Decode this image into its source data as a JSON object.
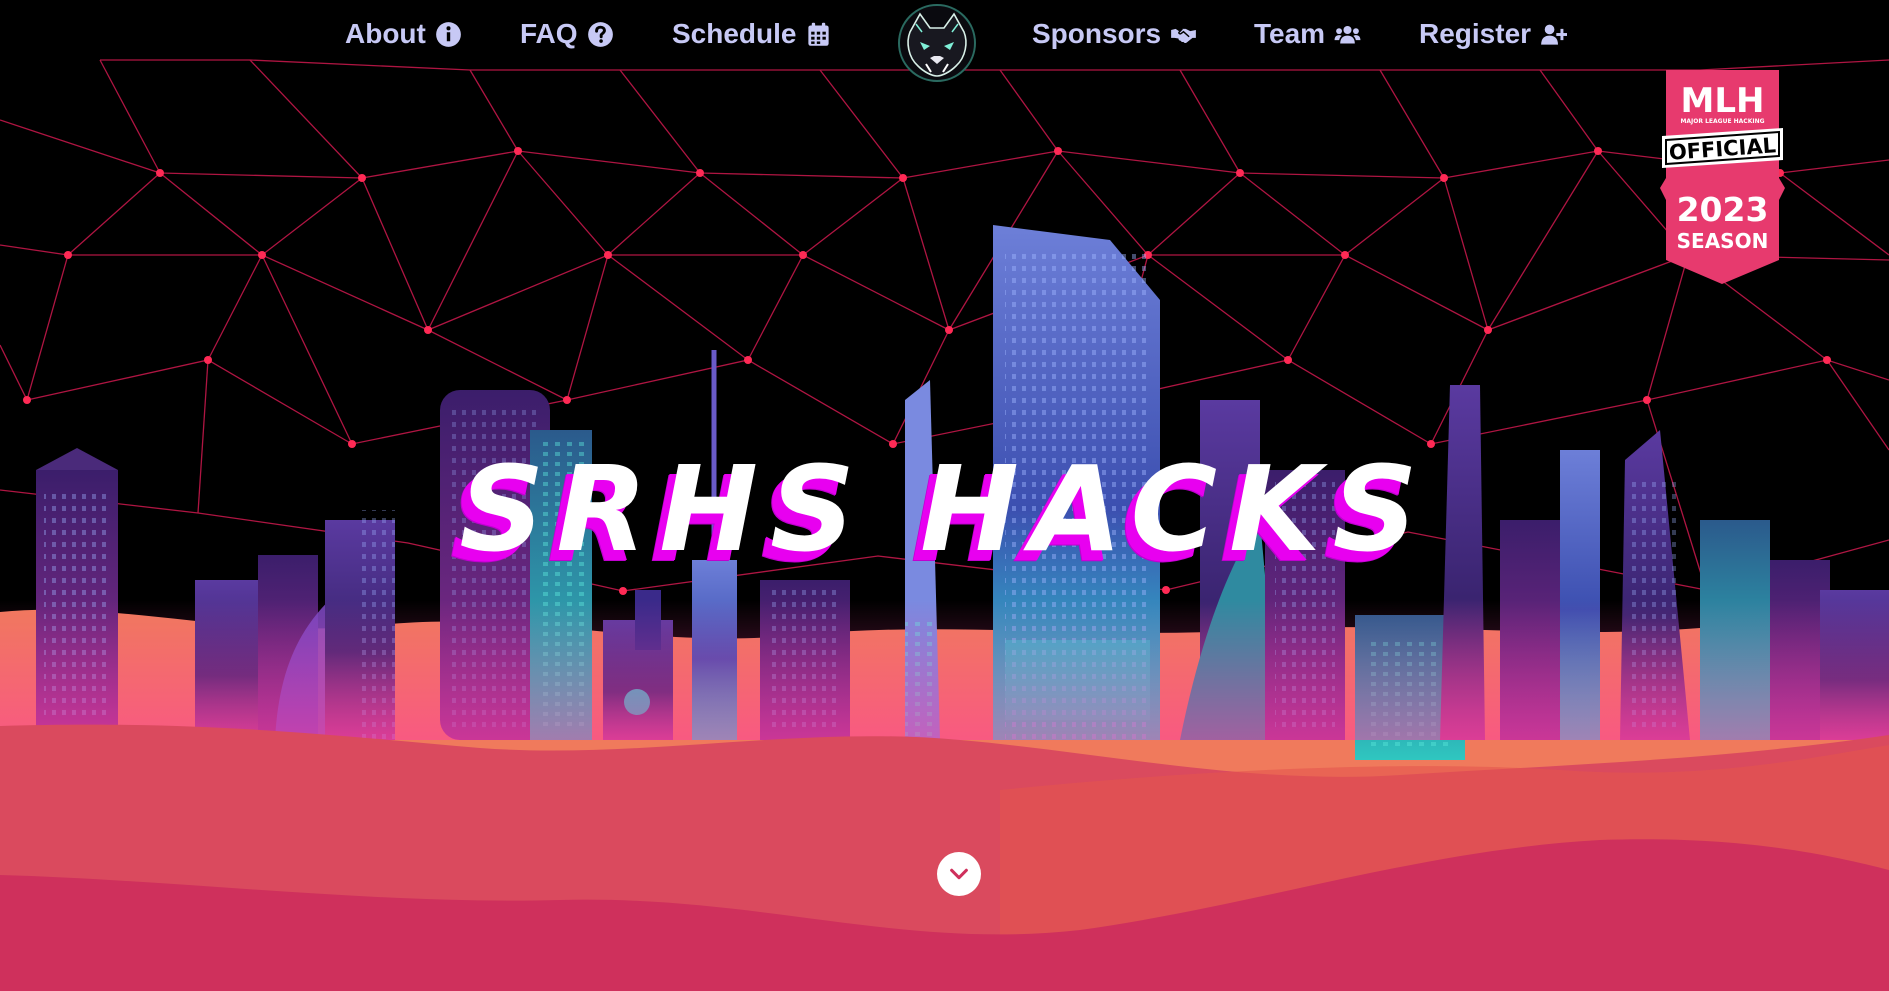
{
  "nav": {
    "about": "About",
    "faq": "FAQ",
    "schedule": "Schedule",
    "sponsors": "Sponsors",
    "team": "Team",
    "register": "Register"
  },
  "hero": {
    "title": "SRHS HACKS"
  },
  "badge": {
    "org": "MLH",
    "org_full": "MAJOR LEAGUE HACKING",
    "label": "OFFICIAL",
    "year": "2023",
    "season": "SEASON"
  },
  "colors": {
    "nav_text": "#c7c9f5",
    "net_line": "#c2184a",
    "net_node": "#ff2a55",
    "title_shadow": "#e800f0",
    "dune_back": "#f07a5c",
    "dune_mid": "#da4a5e",
    "dune_front": "#cf305c",
    "badge_bg": "#e73a6e"
  },
  "icons": {
    "about": "info-circle-icon",
    "faq": "question-circle-icon",
    "schedule": "calendar-icon",
    "sponsors": "handshake-icon",
    "team": "users-icon",
    "register": "user-plus-icon",
    "scroll": "chevron-down-icon",
    "logo": "panther-logo"
  }
}
